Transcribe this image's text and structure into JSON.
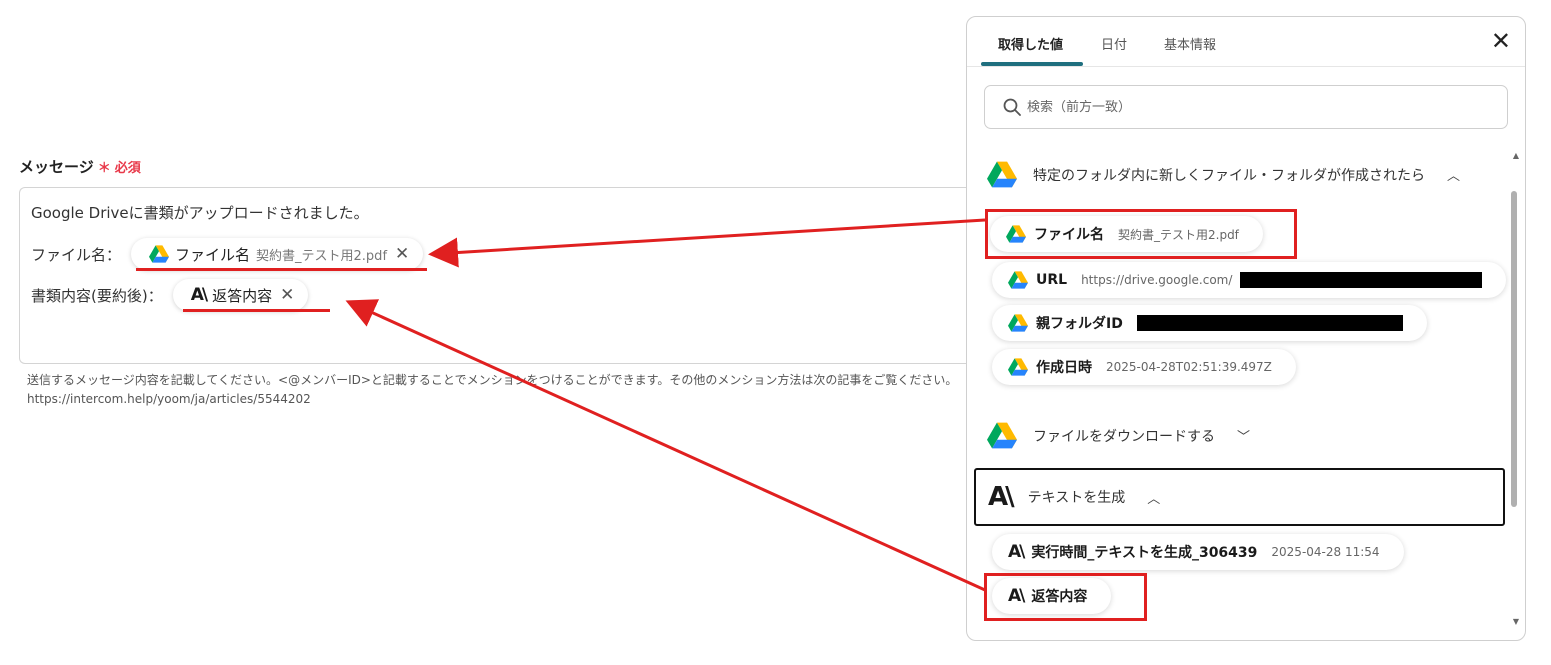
{
  "form": {
    "label": "メッセージ",
    "required_mark": "＊",
    "required_text": "必須",
    "line1": "Google Driveに書類がアップロードされました。",
    "line2_prefix": "ファイル名：",
    "line3_prefix": "書類内容(要約後)：",
    "chip_file": {
      "name": "ファイル名",
      "value": "契約書_テスト用2.pdf"
    },
    "chip_reply": {
      "name": "返答内容"
    },
    "help_line1": "送信するメッセージ内容を記載してください。<@メンバーID>と記載することでメンションをつけることができます。その他のメンション方法は次の記事をご覧ください。",
    "help_line2": "https://intercom.help/yoom/ja/articles/5544202"
  },
  "panel": {
    "tabs": [
      "取得した値",
      "日付",
      "基本情報"
    ],
    "active_tab": 0,
    "search_placeholder": "検索（前方一致）",
    "groups": [
      {
        "title": "特定のフォルダ内に新しくファイル・フォルダが作成されたら",
        "icon": "google-drive-icon",
        "expanded": true,
        "items": [
          {
            "name": "ファイル名",
            "value": "契約書_テスト用2.pdf"
          },
          {
            "name": "URL",
            "value": "https://drive.google.com/"
          },
          {
            "name": "親フォルダID",
            "value": ""
          },
          {
            "name": "作成日時",
            "value": "2025-04-28T02:51:39.497Z"
          }
        ]
      },
      {
        "title": "ファイルをダウンロードする",
        "icon": "google-drive-icon",
        "expanded": false,
        "items": []
      },
      {
        "title": "テキストを生成",
        "icon": "anthropic-icon",
        "expanded": true,
        "items": [
          {
            "name": "実行時間_テキストを生成_306439",
            "value": "2025-04-28 11:54"
          },
          {
            "name": "返答内容",
            "value": ""
          }
        ]
      }
    ]
  },
  "colors": {
    "accent": "#1f6f7f",
    "required": "#e8394a",
    "annotation_red": "#e02020"
  }
}
